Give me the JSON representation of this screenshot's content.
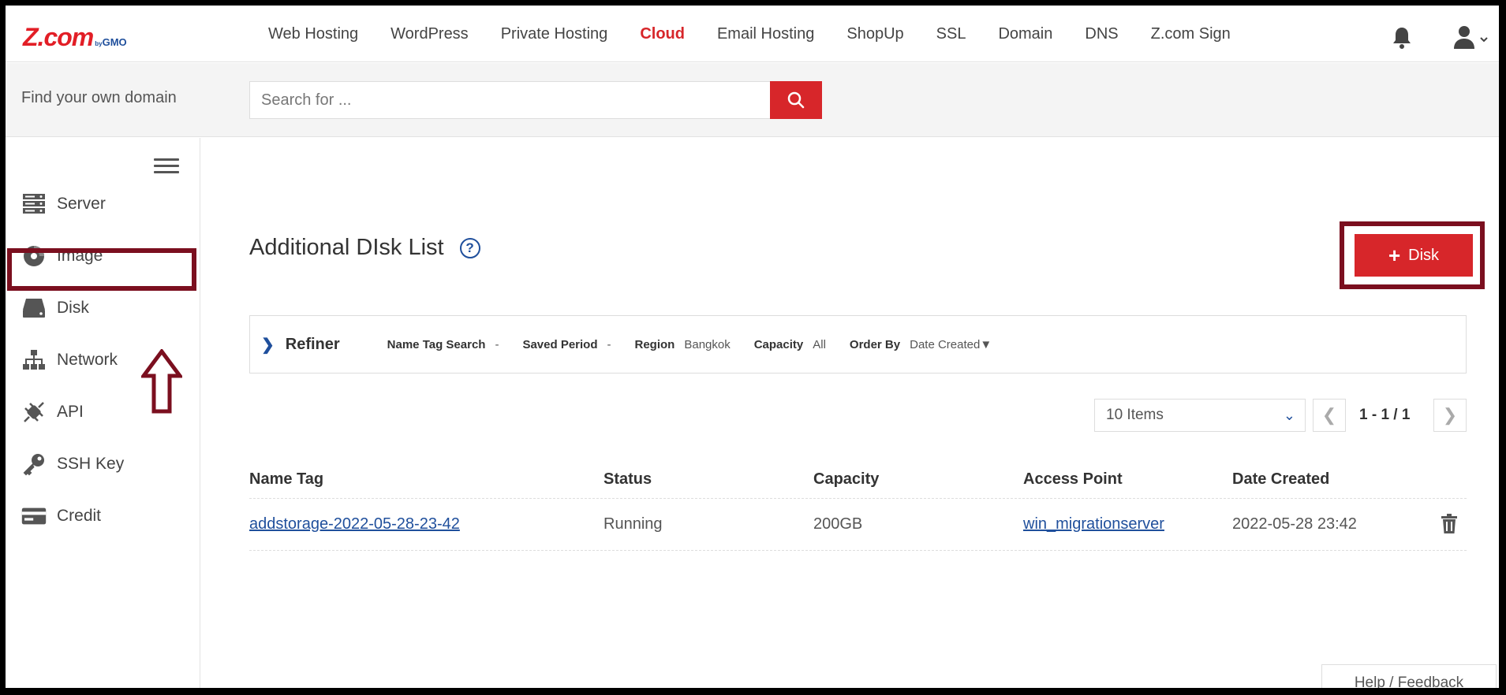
{
  "brand": {
    "logo_text": "Z.com",
    "logo_suffix_by": "by",
    "logo_suffix_gmo": "GMO"
  },
  "nav": {
    "items": [
      {
        "label": "Web Hosting"
      },
      {
        "label": "WordPress"
      },
      {
        "label": "Private Hosting"
      },
      {
        "label": "Cloud",
        "active": true
      },
      {
        "label": "Email Hosting"
      },
      {
        "label": "ShopUp"
      },
      {
        "label": "SSL"
      },
      {
        "label": "Domain"
      },
      {
        "label": "DNS"
      },
      {
        "label": "Z.com Sign"
      }
    ]
  },
  "domain_search": {
    "label": "Find your own domain",
    "placeholder": "Search for ..."
  },
  "sidebar": {
    "items": [
      {
        "label": "Server",
        "icon": "server-icon"
      },
      {
        "label": "Image",
        "icon": "disc-icon"
      },
      {
        "label": "Disk",
        "icon": "disk-icon",
        "selected": true
      },
      {
        "label": "Network",
        "icon": "network-icon"
      },
      {
        "label": "API",
        "icon": "api-plug-icon"
      },
      {
        "label": "SSH Key",
        "icon": "key-icon"
      },
      {
        "label": "Credit",
        "icon": "credit-card-icon"
      }
    ]
  },
  "main": {
    "title": "Additional DIsk List",
    "add_button": {
      "plus": "+",
      "label": "Disk"
    },
    "refiner": {
      "title": "Refiner",
      "filters": [
        {
          "key": "Name Tag Search",
          "value": "-"
        },
        {
          "key": "Saved Period",
          "value": "-"
        },
        {
          "key": "Region",
          "value": "Bangkok"
        },
        {
          "key": "Capacity",
          "value": "All"
        },
        {
          "key": "Order By",
          "value": "Date Created▼"
        }
      ]
    },
    "pagination": {
      "page_size": "10 Items",
      "range": "1 - 1 / 1",
      "prev": "❮",
      "next": "❯"
    },
    "table": {
      "columns": [
        "Name Tag",
        "Status",
        "Capacity",
        "Access Point",
        "Date Created"
      ],
      "rows": [
        {
          "name_tag": "addstorage-2022-05-28-23-42",
          "status": "Running",
          "capacity": "200GB",
          "access_point": "win_migrationserver",
          "date_created": "2022-05-28 23:42"
        }
      ]
    },
    "help": "Help / Feedback"
  },
  "colors": {
    "brand_red": "#d7262a",
    "link_blue": "#1f4f9c",
    "annotation": "#7b0f1f"
  }
}
